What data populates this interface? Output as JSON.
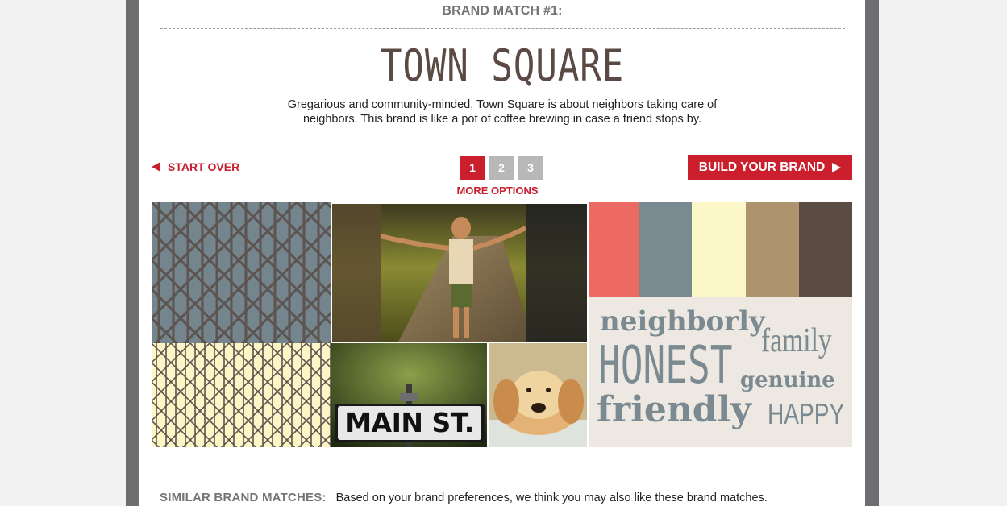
{
  "header": {
    "kicker": "BRAND MATCH #1:",
    "title": "TOWN SQUARE",
    "description": "Gregarious and community-minded, Town Square is about neighbors taking care of neighbors. This brand is like a pot of coffee brewing in case a friend stops by."
  },
  "nav": {
    "start_over": "START OVER",
    "pages": [
      "1",
      "2",
      "3"
    ],
    "active_page": "1",
    "more_options": "MORE OPTIONS",
    "build_brand": "BUILD YOUR BRAND"
  },
  "board": {
    "street_sign": "MAIN ST.",
    "swatches": [
      "#ec6a62",
      "#7a8a91",
      "#fcf7c6",
      "#ae936f",
      "#5b4c43"
    ],
    "pattern_colors": {
      "slate_bg": "#74858e",
      "slate_line": "#5d5450",
      "cream_bg": "#fcf6c6",
      "cream_line": "#5d5450"
    },
    "words": [
      "neighborly",
      "family",
      "HONEST",
      "genuine",
      "friendly",
      "HAPPY"
    ]
  },
  "similar": {
    "label": "SIMILAR BRAND MATCHES:",
    "text": "Based on your brand preferences, we think you may also like these brand matches."
  },
  "colors": {
    "accent": "#cc1f2d",
    "inactive_page": "#b8b8b8",
    "title": "#5a4a43"
  }
}
